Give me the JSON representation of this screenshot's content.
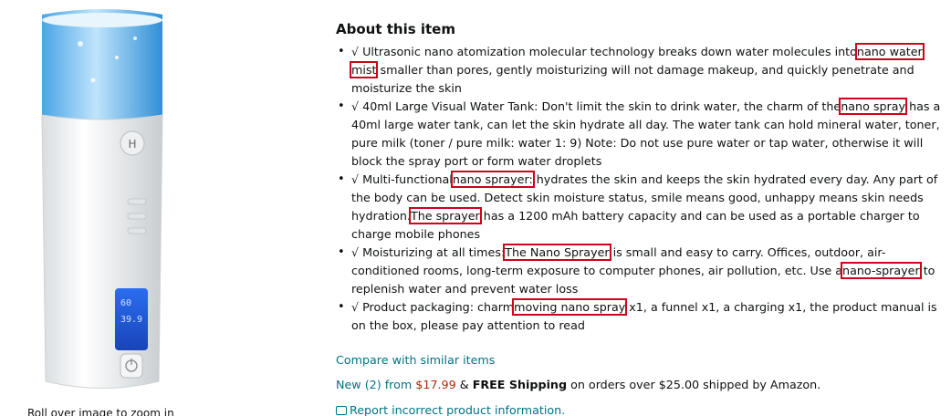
{
  "product_image": {
    "caption": "Roll over image to zoom in",
    "lcd_value_1": "60",
    "lcd_value_2": "39.9"
  },
  "about": {
    "heading": "About this item",
    "bullets": [
      {
        "a": "√ Ultrasonic nano atomization molecular technology breaks down water molecules into",
        "h1": "nano water",
        "b": " ",
        "h2": "mist",
        "c": " smaller than pores, gently moisturizing will not damage makeup, and quickly penetrate and moisturize the skin"
      },
      {
        "a": "√ 40ml Large Visual Water Tank: Don't limit the skin to drink water, the charm of the",
        "h1": "nano spray",
        "b": " has a 40ml large water tank, can let the skin hydrate all day. The water tank can hold mineral water, toner, pure milk (toner / pure milk: water 1: 9) Note: Do not use pure water or tap water, otherwise it will block the spray port or form water droplets"
      },
      {
        "a": "√ Multi-functional",
        "h1": "nano sprayer:",
        "b": " hydrates the skin and keeps the skin hydrated every day. Any part of the body can be used. Detect skin moisture status, smile means good, unhappy means skin needs hydration.",
        "h2": "The sprayer",
        "c": " has a 1200 mAh battery capacity and can be used as a portable charger to charge mobile phones"
      },
      {
        "a": "√ Moisturizing at all times:",
        "h1": "The Nano Sprayer",
        "b": " is small and easy to carry. Offices, outdoor, air-conditioned rooms, long-term exposure to computer phones, air pollution, etc. Use a",
        "h2": "nano-sprayer",
        "c": " to replenish water and prevent water loss"
      },
      {
        "a": "√ Product packaging: charm",
        "h1": "moving nano spray",
        "b": " x1, a funnel x1, a charging x1, the product manual is on the box, please pay attention to read"
      }
    ]
  },
  "compare_link": "Compare with similar items",
  "offer": {
    "new_label": "New (2) from",
    "price": "$17.99",
    "amp": "&",
    "shipping": "FREE Shipping",
    "rest": "on orders over $25.00 shipped by Amazon."
  },
  "report_link": "Report incorrect product information."
}
